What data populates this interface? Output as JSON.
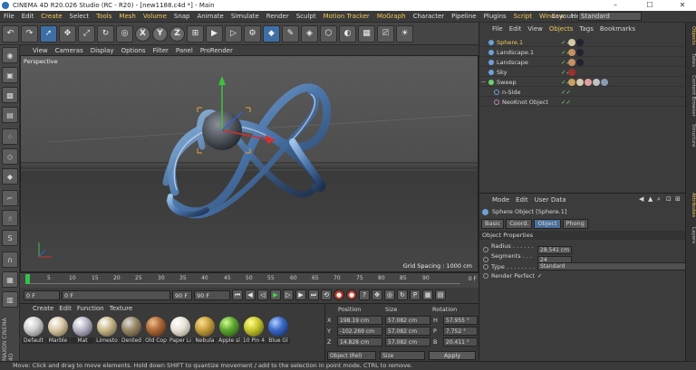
{
  "window": {
    "title": "CINEMA 4D R20.026 Studio (RC - R20) - [new1188.c4d *] - Main",
    "min": "–",
    "max": "☐",
    "close": "✕"
  },
  "menubar": {
    "items": [
      "File",
      "Edit",
      "Create",
      "Select",
      "Tools",
      "Mesh",
      "Volume",
      "Snap",
      "Animate",
      "Simulate",
      "Render",
      "Sculpt",
      "Motion Tracker",
      "MoGraph",
      "Character",
      "Pipeline",
      "Plugins",
      "Script",
      "Window",
      "Help"
    ],
    "highlighted": [
      "Create",
      "Tools",
      "Mesh",
      "Volume",
      "Motion Tracker",
      "MoGraph",
      "Script",
      "Window"
    ],
    "layout_label": "Layout:",
    "layout_value": "Standard"
  },
  "toolbar": {
    "icons": [
      "undo",
      "redo",
      "select-arrow",
      "move",
      "scale",
      "rotate",
      "live-select",
      "x-axis",
      "y-axis",
      "z-axis",
      "coordinate-system",
      "render-view",
      "render-picture-viewer",
      "edit-render-settings",
      "cube",
      "pen",
      "subdivision",
      "extrude",
      "deformer",
      "floor",
      "camera",
      "light"
    ],
    "axis_labels": [
      "X",
      "Y",
      "Z"
    ]
  },
  "viewport": {
    "menu": [
      "View",
      "Cameras",
      "Display",
      "Options",
      "Filter",
      "Panel",
      "ProRender"
    ],
    "label": "Perspective",
    "grid_spacing": "Grid Spacing : 1000 cm"
  },
  "timeline": {
    "ticks": [
      "0",
      "5",
      "10",
      "15",
      "20",
      "25",
      "30",
      "35",
      "40",
      "45",
      "50",
      "55",
      "60",
      "65",
      "70",
      "75",
      "80",
      "85",
      "90"
    ],
    "end_label": "0 F"
  },
  "playbar": {
    "start": "0 F",
    "current": "0 F",
    "end": "90 F",
    "end2": "90 F"
  },
  "materials": {
    "menu": [
      "Create",
      "Edit",
      "Function",
      "Texture"
    ],
    "items": [
      {
        "name": "Default",
        "color": "#cfcfcf"
      },
      {
        "name": "Marble",
        "color": "#d9c9a8"
      },
      {
        "name": "Mat",
        "color": "#b8b8c8"
      },
      {
        "name": "Limesto",
        "color": "#c9b98a"
      },
      {
        "name": "Dented",
        "color": "#9a8a6a"
      },
      {
        "name": "Old Cop",
        "color": "#b06a3a"
      },
      {
        "name": "Paper Li",
        "color": "#e8e4d8"
      },
      {
        "name": "Nebula",
        "color": "#c8a040"
      },
      {
        "name": "Apple sl",
        "color": "#5fa832"
      },
      {
        "name": "10 Pin 4",
        "color": "#c8c830"
      },
      {
        "name": "Blue Gl",
        "color": "#3a6ac8"
      }
    ]
  },
  "coordinates": {
    "headers": [
      "Position",
      "Size",
      "Rotation"
    ],
    "rows": [
      {
        "axis": "X",
        "pos": "198.19 cm",
        "size": "57.082 cm",
        "rot_label": "H",
        "rot": "57.955 °"
      },
      {
        "axis": "Y",
        "pos": "-102.269 cm",
        "size": "57.082 cm",
        "rot_label": "P",
        "rot": "7.752 °"
      },
      {
        "axis": "Z",
        "pos": "14.828 cm",
        "size": "57.082 cm",
        "rot_label": "B",
        "rot": "20.411 °"
      }
    ],
    "mode": "Object (Rel)",
    "size_mode": "Size",
    "apply": "Apply"
  },
  "objects": {
    "menu": [
      "File",
      "Edit",
      "View",
      "Objects",
      "Tags",
      "Bookmarks"
    ],
    "active_menu": "Objects",
    "items": [
      {
        "name": "Sphere.1",
        "indent": 0,
        "color": "#6fa0d8",
        "selected": true,
        "tags": [
          "#d8c8a8",
          "#222233"
        ]
      },
      {
        "name": "Landscape.1",
        "indent": 0,
        "color": "#6fa0d8",
        "selected": false,
        "tags": [
          "#c89060",
          "#222233"
        ]
      },
      {
        "name": "Landscape",
        "indent": 0,
        "color": "#6fa0d8",
        "selected": false,
        "tags": [
          "#c89060",
          "#222233"
        ]
      },
      {
        "name": "Sky",
        "indent": 0,
        "color": "#6fa0d8",
        "selected": false,
        "tags": [
          "#a03030"
        ]
      },
      {
        "name": "Sweep",
        "indent": 0,
        "color": "#6fd06f",
        "selected": false,
        "tags": [
          "#c8a060",
          "#d8c8b0",
          "#e0a0a0",
          "#c0c0c0",
          "#8a9ab0"
        ]
      },
      {
        "name": "n-Side",
        "indent": 1,
        "color": "#6fa0d8",
        "selected": false,
        "tags": []
      },
      {
        "name": "NeoKnot Object",
        "indent": 1,
        "color": "#c080c0",
        "selected": false,
        "tags": []
      }
    ]
  },
  "attributes": {
    "menu": [
      "Mode",
      "Edit",
      "User Data"
    ],
    "object_title": "Sphere Object [Sphere.1]",
    "tabs": [
      "Basic",
      "Coord.",
      "Object",
      "Phong"
    ],
    "active_tab": "Object",
    "section": "Object Properties",
    "props": [
      {
        "label": "Radius . . . . . . .",
        "value": "28.541 cm"
      },
      {
        "label": "Segments . . . . .",
        "value": "24"
      },
      {
        "label": "Type . . . . . . . .",
        "value": "Standard"
      },
      {
        "label": "Render Perfect",
        "value": "✓"
      }
    ]
  },
  "right_tabs": [
    "Objects",
    "Takes",
    "Content Browser",
    "Structure",
    "Attributes",
    "Layers"
  ],
  "statusbar": {
    "text": "Move: Click and drag to move elements. Hold down SHIFT to quantize movement / add to the selection in point mode, CTRL to remove."
  }
}
